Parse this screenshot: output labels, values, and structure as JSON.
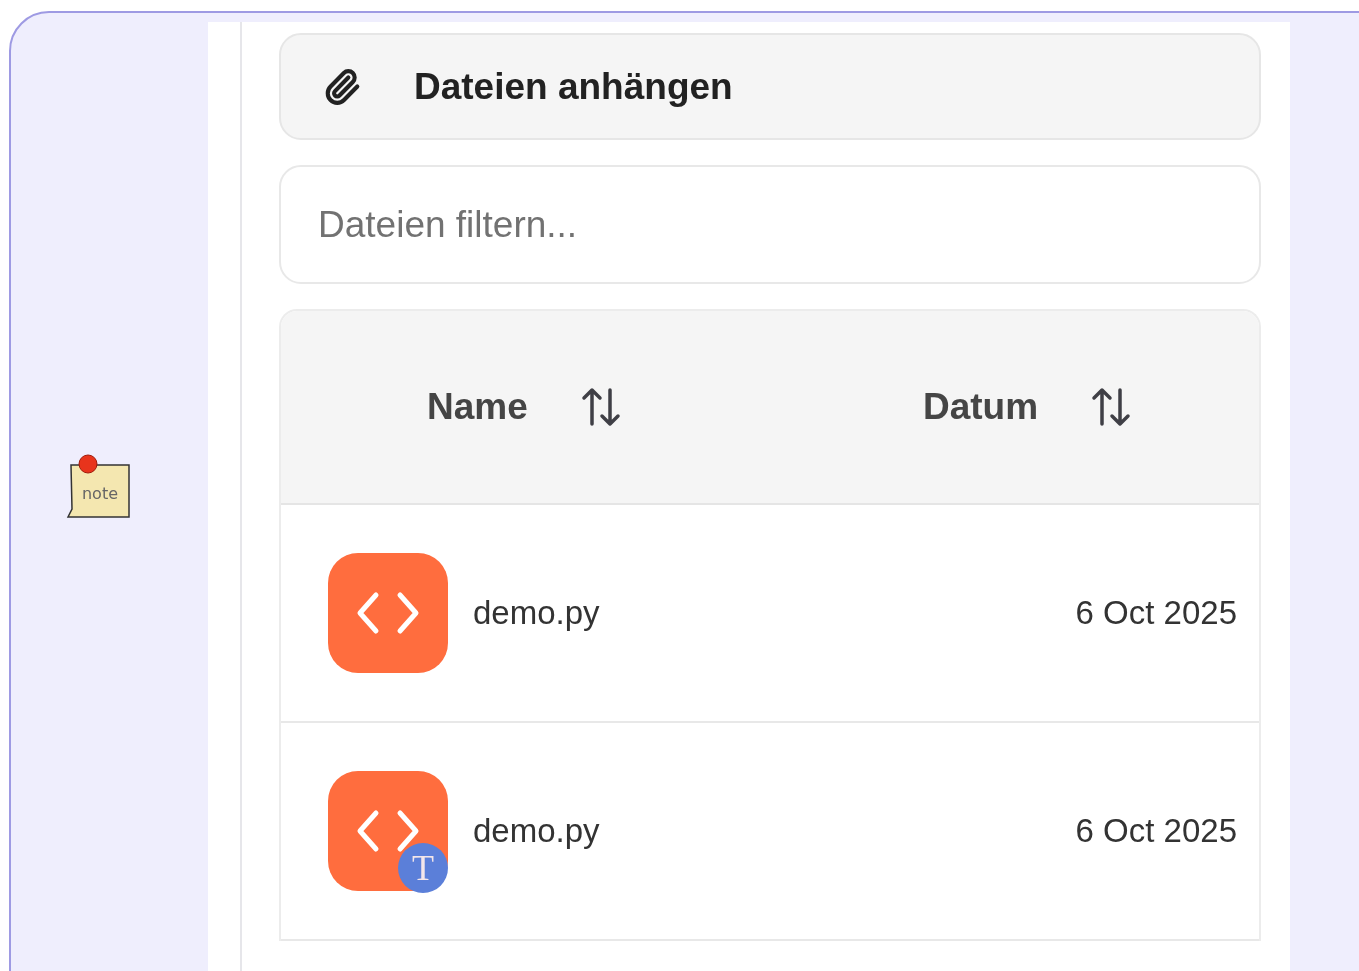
{
  "note_icon": {
    "label": "note"
  },
  "attach_button": {
    "label": "Dateien anhängen"
  },
  "filter": {
    "placeholder": "Dateien filtern..."
  },
  "table": {
    "columns": [
      {
        "label": "Name",
        "sortable": true
      },
      {
        "label": "Datum",
        "sortable": true
      }
    ],
    "rows": [
      {
        "name": "demo.py",
        "date": "6 Oct 2025",
        "badge": null
      },
      {
        "name": "demo.py",
        "date": "6 Oct 2025",
        "badge": "T"
      }
    ]
  }
}
